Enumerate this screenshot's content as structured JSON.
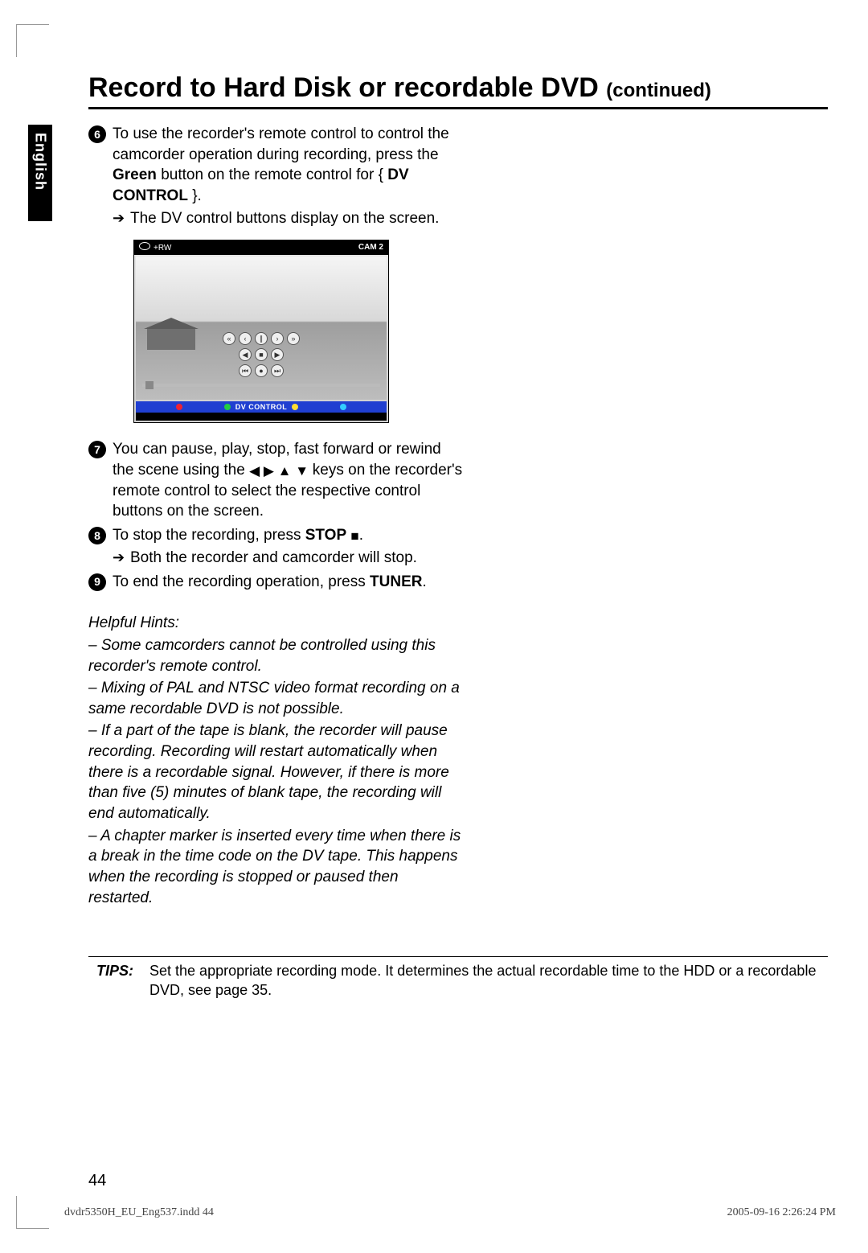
{
  "language_tab": "English",
  "title_main": "Record to Hard Disk or recordable DVD ",
  "title_cont": "(continued)",
  "steps": {
    "s6": {
      "num": "6",
      "pre": "To use the recorder's remote control to control the camcorder operation during recording, press the ",
      "green": "Green",
      "mid": " button on the remote control for { ",
      "dvctrl": "DV CONTROL",
      "post": " }.",
      "arrow": "The DV control buttons display on the screen."
    },
    "s7": {
      "num": "7",
      "pre": "You can pause, play, stop, fast forward or rewind the scene using the ",
      "post": " keys on the recorder's remote control to select the respective control buttons on the screen."
    },
    "s8": {
      "num": "8",
      "pre": "To stop the recording, press ",
      "stop": "STOP",
      "post": ".",
      "arrow": "Both the recorder and camcorder will stop."
    },
    "s9": {
      "num": "9",
      "pre": "To end the recording operation, press ",
      "tuner": "TUNER",
      "post": "."
    }
  },
  "screen": {
    "rw": "+RW",
    "cam": "CAM 2",
    "label": "DV CONTROL"
  },
  "hints": {
    "title": "Helpful Hints:",
    "h1": "– Some camcorders cannot be controlled using this recorder's remote control.",
    "h2": "– Mixing of PAL and NTSC video format recording on a same recordable DVD is not possible.",
    "h3": "– If a part of the tape is blank, the recorder will pause recording. Recording will restart automatically when there is a recordable signal. However, if there is more than five (5) minutes of blank tape, the recording will end automatically.",
    "h4": "– A chapter marker is inserted every time when there is a break in the time code on the DV tape. This happens when the recording is stopped or paused then restarted."
  },
  "tips": {
    "label": "TIPS:",
    "text": "Set the appropriate recording mode. It determines the actual recordable time to the HDD or a recordable DVD, see page 35."
  },
  "page_number": "44",
  "footer_left": "dvdr5350H_EU_Eng537.indd   44",
  "footer_right": "2005-09-16   2:26:24 PM"
}
